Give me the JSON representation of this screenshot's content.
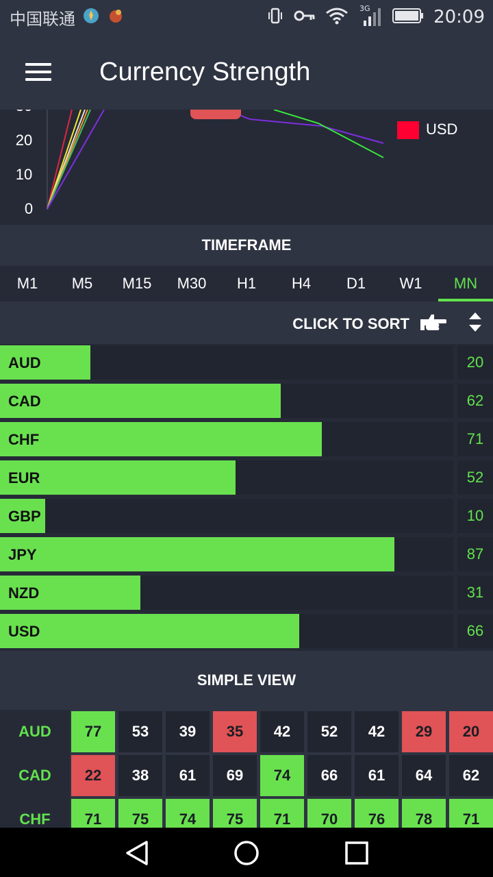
{
  "status_bar": {
    "carrier": "中国联通",
    "time": "20:09",
    "network": "3G"
  },
  "header": {
    "title": "Currency Strength"
  },
  "chart_data": {
    "type": "line",
    "y_ticks": [
      "20",
      "10",
      "0"
    ],
    "legend": [
      {
        "name": "USD",
        "color": "#ff0033"
      }
    ]
  },
  "timeframe": {
    "title": "TIMEFRAME",
    "tabs": [
      {
        "label": "M1"
      },
      {
        "label": "M5"
      },
      {
        "label": "M15"
      },
      {
        "label": "M30"
      },
      {
        "label": "H1"
      },
      {
        "label": "H4"
      },
      {
        "label": "D1"
      },
      {
        "label": "W1"
      },
      {
        "label": "MN"
      }
    ],
    "active": "MN"
  },
  "sort": {
    "label": "CLICK TO SORT"
  },
  "strength": [
    {
      "currency": "AUD",
      "value": 20,
      "fill_pct": 20
    },
    {
      "currency": "CAD",
      "value": 62,
      "fill_pct": 62
    },
    {
      "currency": "CHF",
      "value": 71,
      "fill_pct": 71
    },
    {
      "currency": "EUR",
      "value": 52,
      "fill_pct": 52
    },
    {
      "currency": "GBP",
      "value": 10,
      "fill_pct": 10
    },
    {
      "currency": "JPY",
      "value": 87,
      "fill_pct": 87
    },
    {
      "currency": "NZD",
      "value": 31,
      "fill_pct": 31
    },
    {
      "currency": "USD",
      "value": 66,
      "fill_pct": 66
    }
  ],
  "simple_view": {
    "title": "SIMPLE VIEW",
    "rows": [
      {
        "currency": "AUD",
        "cells": [
          {
            "v": "77",
            "s": "hi"
          },
          {
            "v": "53",
            "s": ""
          },
          {
            "v": "39",
            "s": ""
          },
          {
            "v": "35",
            "s": "lo"
          },
          {
            "v": "42",
            "s": ""
          },
          {
            "v": "52",
            "s": ""
          },
          {
            "v": "42",
            "s": ""
          },
          {
            "v": "29",
            "s": "lo"
          },
          {
            "v": "20",
            "s": "lo"
          }
        ]
      },
      {
        "currency": "CAD",
        "cells": [
          {
            "v": "22",
            "s": "lo"
          },
          {
            "v": "38",
            "s": ""
          },
          {
            "v": "61",
            "s": ""
          },
          {
            "v": "69",
            "s": ""
          },
          {
            "v": "74",
            "s": "hi"
          },
          {
            "v": "66",
            "s": ""
          },
          {
            "v": "61",
            "s": ""
          },
          {
            "v": "64",
            "s": ""
          },
          {
            "v": "62",
            "s": ""
          }
        ]
      },
      {
        "currency": "CHF",
        "cells": [
          {
            "v": "71",
            "s": "hi"
          },
          {
            "v": "75",
            "s": "hi"
          },
          {
            "v": "74",
            "s": "hi"
          },
          {
            "v": "75",
            "s": "hi"
          },
          {
            "v": "71",
            "s": "hi"
          },
          {
            "v": "70",
            "s": "hi"
          },
          {
            "v": "76",
            "s": "hi"
          },
          {
            "v": "78",
            "s": "hi"
          },
          {
            "v": "71",
            "s": "hi"
          }
        ]
      }
    ]
  }
}
